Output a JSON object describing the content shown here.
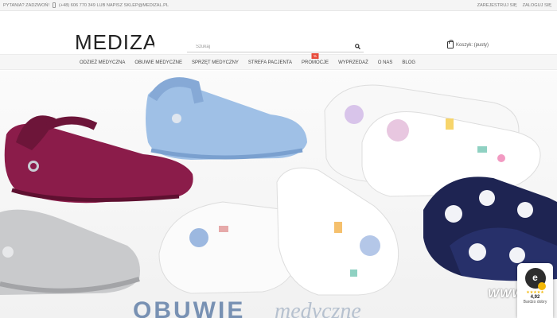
{
  "topbar": {
    "contact_text": "PYTANIA? ZADZWOŃ!",
    "phone_text": "(+48) 606 770 349 LUB NAPISZ SKLEP@MEDIZAL.PL",
    "register": "ZAREJESTRUJ SIĘ",
    "login": "ZALOGUJ SIĘ"
  },
  "header": {
    "logo_text": "MEDIZAL",
    "search_placeholder": "Szukaj",
    "cart_label": "Koszyk: (pusty)"
  },
  "nav": {
    "items": [
      {
        "label": "ODZIEŻ MEDYCZNA"
      },
      {
        "label": "OBUWIE MEDYCZNE"
      },
      {
        "label": "SPRZĘT MEDYCZNY"
      },
      {
        "label": "STREFA PACJENTA"
      },
      {
        "label": "PROMOCJE",
        "badge": "%"
      },
      {
        "label": "WYPRZEDAŻ"
      },
      {
        "label": "O NAS"
      },
      {
        "label": "BLOG"
      }
    ]
  },
  "hero": {
    "title": "OBUWIE",
    "subtitle": "medyczne",
    "watermark": "WWW"
  },
  "rating_badge": {
    "score": "4,92",
    "label": "Bardzo dobry"
  },
  "colors": {
    "accent_red": "#e74c3c",
    "magenta_clog": "#8b1c4a",
    "blue_clog": "#9fc0e6",
    "silver_clog": "#c9cacc",
    "navy_clog": "#1e2452"
  }
}
